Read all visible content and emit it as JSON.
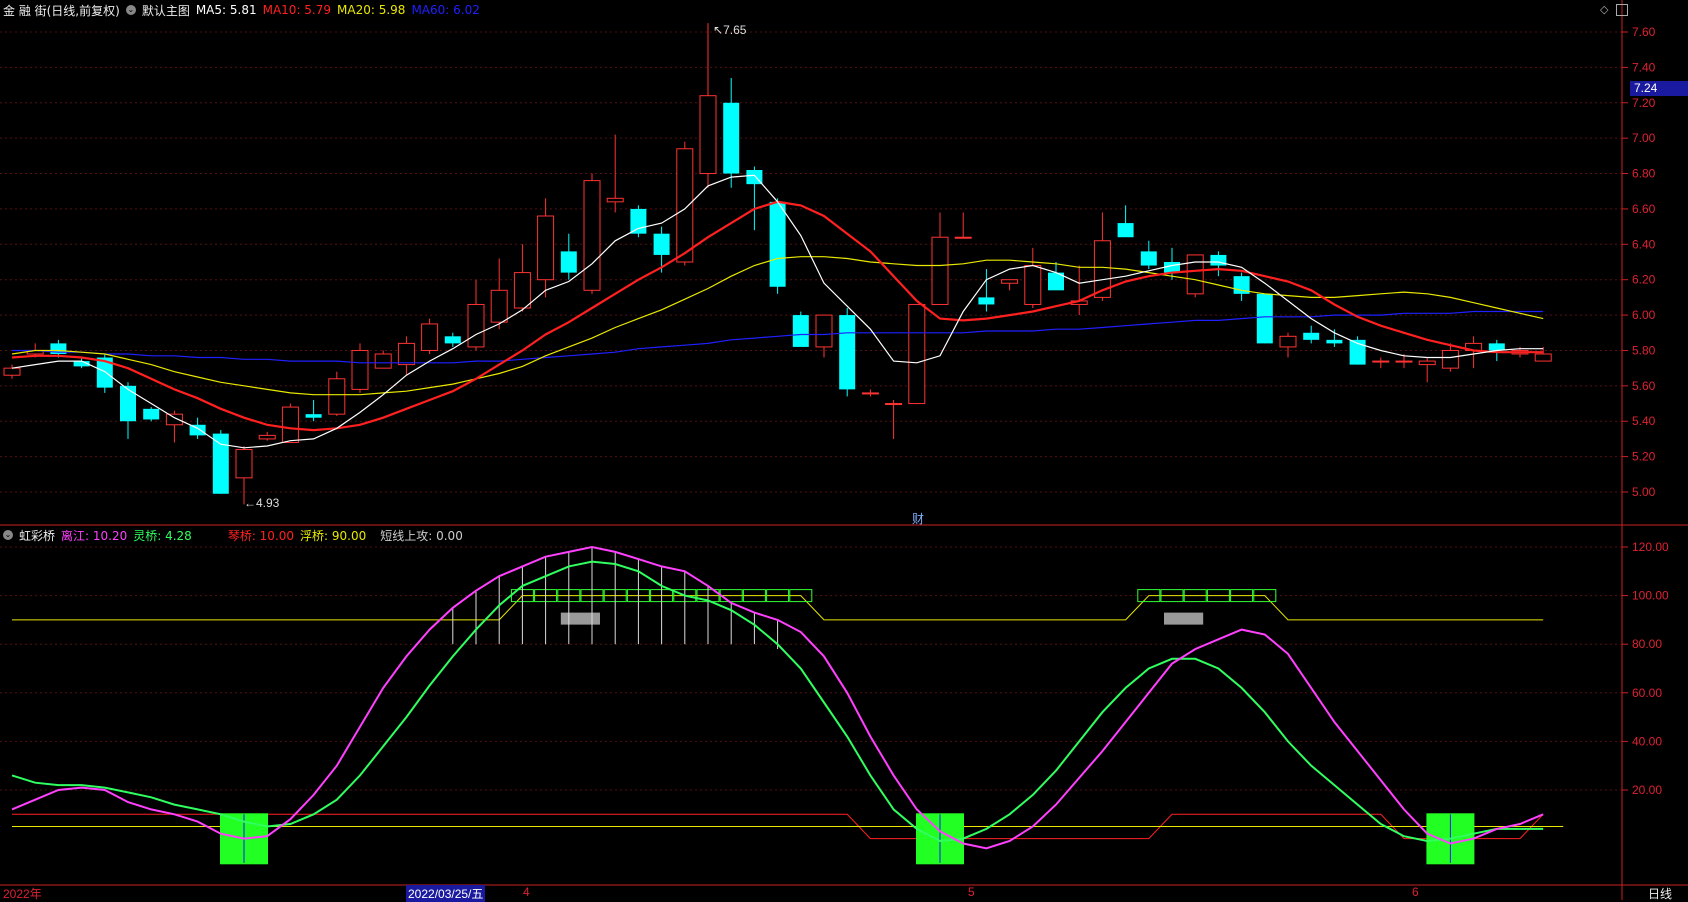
{
  "main_header": {
    "stock": "金 融 街(日线,前复权)",
    "indicator_icon": "circle-chevron-icon",
    "indicator_name": "默认主图",
    "ma5": "MA5: 5.81",
    "ma10": "MA10: 5.79",
    "ma20": "MA20: 5.98",
    "ma60": "MA60: 6.02"
  },
  "sub_header": {
    "indicator_icon": "circle-chevron-icon",
    "name": "虹彩桥",
    "v1": "离江: 10.20",
    "v2": "灵桥: 4.28",
    "v3": "琴桥: 10.00",
    "v4": "浮桥: 90.00",
    "v5": "短线上攻: 0.00"
  },
  "colors": {
    "bg": "#000000",
    "up": "#ff3333",
    "down": "#00ffff",
    "ma5": "#ffffff",
    "ma10": "#ff2020",
    "ma20": "#e8e800",
    "ma60": "#2020ff",
    "axis": "#cc2222"
  },
  "main_axis": {
    "min": 4.8,
    "max": 7.7,
    "ticks": [
      "7.60",
      "7.40",
      "7.20",
      "7.00",
      "6.80",
      "6.60",
      "6.40",
      "6.20",
      "6.00",
      "5.80",
      "5.60",
      "5.40",
      "5.20",
      "5.00"
    ],
    "current_price": "7.24",
    "high_label": "7.65",
    "low_label": "4.93",
    "fin_marker": "财"
  },
  "sub_axis": {
    "min": -10,
    "max": 130,
    "ticks": [
      "120.00",
      "100.00",
      "80.00",
      "60.00",
      "40.00",
      "20.00"
    ]
  },
  "date_axis": {
    "labels": [
      "2022年",
      "2022/03/25/五",
      "4",
      "5",
      "6"
    ],
    "period": "日线"
  },
  "chart_data": {
    "type": "candlestick",
    "candles": [
      [
        5.66,
        5.72,
        5.64,
        5.7
      ],
      [
        5.78,
        5.84,
        5.76,
        5.8
      ],
      [
        5.84,
        5.86,
        5.76,
        5.78
      ],
      [
        5.74,
        5.76,
        5.7,
        5.71
      ],
      [
        5.76,
        5.78,
        5.56,
        5.59
      ],
      [
        5.6,
        5.62,
        5.3,
        5.4
      ],
      [
        5.47,
        5.48,
        5.4,
        5.41
      ],
      [
        5.38,
        5.46,
        5.28,
        5.44
      ],
      [
        5.38,
        5.42,
        5.3,
        5.32
      ],
      [
        5.33,
        5.35,
        4.99,
        4.99
      ],
      [
        5.08,
        5.26,
        4.93,
        5.24
      ],
      [
        5.3,
        5.34,
        5.29,
        5.32
      ],
      [
        5.28,
        5.5,
        5.28,
        5.48
      ],
      [
        5.44,
        5.52,
        5.4,
        5.42
      ],
      [
        5.44,
        5.68,
        5.43,
        5.64
      ],
      [
        5.58,
        5.84,
        5.56,
        5.8
      ],
      [
        5.7,
        5.8,
        5.7,
        5.78
      ],
      [
        5.72,
        5.88,
        5.66,
        5.84
      ],
      [
        5.8,
        5.98,
        5.78,
        5.95
      ],
      [
        5.88,
        5.9,
        5.82,
        5.84
      ],
      [
        5.82,
        6.2,
        5.8,
        6.06
      ],
      [
        5.96,
        6.32,
        5.92,
        6.14
      ],
      [
        6.04,
        6.4,
        6.02,
        6.24
      ],
      [
        6.2,
        6.66,
        6.1,
        6.56
      ],
      [
        6.36,
        6.46,
        6.2,
        6.24
      ],
      [
        6.14,
        6.8,
        6.12,
        6.76
      ],
      [
        6.64,
        7.02,
        6.58,
        6.66
      ],
      [
        6.6,
        6.62,
        6.44,
        6.46
      ],
      [
        6.46,
        6.5,
        6.24,
        6.34
      ],
      [
        6.3,
        6.98,
        6.28,
        6.94
      ],
      [
        6.8,
        7.65,
        6.72,
        7.24
      ],
      [
        7.2,
        7.34,
        6.72,
        6.8
      ],
      [
        6.82,
        6.84,
        6.48,
        6.74
      ],
      [
        6.64,
        6.66,
        6.12,
        6.16
      ],
      [
        6.0,
        6.02,
        5.88,
        5.82
      ],
      [
        5.82,
        6.0,
        5.76,
        6.0
      ],
      [
        6.0,
        6.04,
        5.54,
        5.58
      ],
      [
        5.56,
        5.58,
        5.54,
        5.56
      ],
      [
        5.5,
        5.52,
        5.3,
        5.5
      ],
      [
        5.5,
        6.06,
        5.5,
        6.06
      ],
      [
        6.06,
        6.58,
        6.06,
        6.44
      ],
      [
        6.44,
        6.58,
        6.44,
        6.44
      ],
      [
        6.1,
        6.26,
        6.02,
        6.06
      ],
      [
        6.18,
        6.2,
        6.14,
        6.2
      ],
      [
        6.06,
        6.38,
        6.04,
        6.28
      ],
      [
        6.24,
        6.3,
        6.14,
        6.14
      ],
      [
        6.06,
        6.28,
        6.0,
        6.08
      ],
      [
        6.1,
        6.58,
        6.08,
        6.42
      ],
      [
        6.52,
        6.62,
        6.46,
        6.44
      ],
      [
        6.36,
        6.42,
        6.26,
        6.28
      ],
      [
        6.3,
        6.38,
        6.2,
        6.24
      ],
      [
        6.12,
        6.34,
        6.1,
        6.34
      ],
      [
        6.34,
        6.36,
        6.22,
        6.28
      ],
      [
        6.22,
        6.24,
        6.08,
        6.12
      ],
      [
        6.12,
        6.12,
        5.84,
        5.84
      ],
      [
        5.82,
        5.9,
        5.76,
        5.88
      ],
      [
        5.9,
        5.94,
        5.84,
        5.86
      ],
      [
        5.86,
        5.92,
        5.82,
        5.84
      ],
      [
        5.86,
        5.88,
        5.72,
        5.72
      ],
      [
        5.74,
        5.76,
        5.7,
        5.74
      ],
      [
        5.74,
        5.78,
        5.7,
        5.74
      ],
      [
        5.72,
        5.76,
        5.62,
        5.74
      ],
      [
        5.7,
        5.84,
        5.68,
        5.8
      ],
      [
        5.8,
        5.88,
        5.7,
        5.84
      ],
      [
        5.84,
        5.86,
        5.74,
        5.8
      ],
      [
        5.78,
        5.82,
        5.76,
        5.8
      ],
      [
        5.74,
        5.82,
        5.74,
        5.78
      ]
    ],
    "ma5": [
      5.7,
      5.72,
      5.74,
      5.74,
      5.68,
      5.58,
      5.5,
      5.42,
      5.36,
      5.27,
      5.25,
      5.26,
      5.29,
      5.3,
      5.36,
      5.45,
      5.55,
      5.66,
      5.74,
      5.81,
      5.89,
      5.95,
      6.03,
      6.14,
      6.19,
      6.29,
      6.42,
      6.49,
      6.52,
      6.6,
      6.73,
      6.78,
      6.79,
      6.64,
      6.45,
      6.18,
      6.05,
      5.92,
      5.74,
      5.73,
      5.77,
      6.02,
      6.2,
      6.26,
      6.28,
      6.24,
      6.18,
      6.2,
      6.22,
      6.25,
      6.28,
      6.3,
      6.3,
      6.27,
      6.18,
      6.08,
      5.98,
      5.9,
      5.84,
      5.8,
      5.77,
      5.76,
      5.76,
      5.78,
      5.8,
      5.81,
      5.81
    ],
    "ma10": [
      5.76,
      5.77,
      5.77,
      5.76,
      5.74,
      5.7,
      5.64,
      5.58,
      5.53,
      5.47,
      5.42,
      5.38,
      5.36,
      5.35,
      5.36,
      5.38,
      5.42,
      5.47,
      5.52,
      5.57,
      5.64,
      5.72,
      5.8,
      5.89,
      5.96,
      6.04,
      6.12,
      6.2,
      6.27,
      6.35,
      6.44,
      6.52,
      6.6,
      6.64,
      6.62,
      6.56,
      6.46,
      6.36,
      6.22,
      6.08,
      5.98,
      5.97,
      5.98,
      6.0,
      6.02,
      6.05,
      6.08,
      6.14,
      6.19,
      6.22,
      6.24,
      6.25,
      6.26,
      6.25,
      6.22,
      6.19,
      6.14,
      6.06,
      5.99,
      5.94,
      5.9,
      5.86,
      5.83,
      5.8,
      5.79,
      5.79,
      5.79
    ],
    "ma20": [
      5.78,
      5.8,
      5.8,
      5.79,
      5.78,
      5.75,
      5.72,
      5.68,
      5.65,
      5.62,
      5.6,
      5.58,
      5.56,
      5.55,
      5.55,
      5.55,
      5.56,
      5.57,
      5.59,
      5.61,
      5.64,
      5.67,
      5.71,
      5.77,
      5.82,
      5.87,
      5.93,
      5.98,
      6.03,
      6.09,
      6.15,
      6.22,
      6.28,
      6.32,
      6.33,
      6.33,
      6.32,
      6.3,
      6.29,
      6.28,
      6.28,
      6.29,
      6.31,
      6.31,
      6.3,
      6.29,
      6.27,
      6.27,
      6.26,
      6.24,
      6.22,
      6.2,
      6.17,
      6.14,
      6.12,
      6.11,
      6.1,
      6.1,
      6.11,
      6.12,
      6.13,
      6.12,
      6.1,
      6.07,
      6.04,
      6.01,
      5.98
    ],
    "ma60": [
      5.8,
      5.8,
      5.79,
      5.79,
      5.78,
      5.78,
      5.77,
      5.77,
      5.76,
      5.76,
      5.75,
      5.75,
      5.74,
      5.74,
      5.74,
      5.73,
      5.73,
      5.73,
      5.73,
      5.73,
      5.74,
      5.74,
      5.75,
      5.76,
      5.77,
      5.78,
      5.79,
      5.81,
      5.82,
      5.83,
      5.84,
      5.86,
      5.87,
      5.88,
      5.89,
      5.89,
      5.9,
      5.9,
      5.9,
      5.9,
      5.9,
      5.9,
      5.91,
      5.91,
      5.91,
      5.92,
      5.92,
      5.93,
      5.94,
      5.95,
      5.96,
      5.97,
      5.97,
      5.98,
      5.99,
      5.99,
      5.99,
      6.0,
      6.0,
      6.0,
      6.01,
      6.01,
      6.01,
      6.02,
      6.02,
      6.02,
      6.02
    ],
    "lijiang": [
      12,
      16,
      20,
      21,
      20,
      15,
      12,
      10,
      7,
      2,
      0,
      1,
      8,
      18,
      30,
      46,
      62,
      75,
      86,
      95,
      102,
      108,
      112,
      116,
      118,
      120,
      118,
      115,
      112,
      110,
      104,
      97,
      93,
      90,
      85,
      75,
      60,
      42,
      26,
      12,
      3,
      -2,
      -4,
      -1,
      5,
      14,
      25,
      36,
      48,
      60,
      72,
      78,
      82,
      86,
      84,
      76,
      62,
      48,
      36,
      24,
      12,
      2,
      -2,
      0,
      4,
      6,
      10
    ],
    "lingqiao": [
      26,
      23,
      22,
      22,
      21,
      19,
      17,
      14,
      12,
      10,
      7,
      5,
      6,
      10,
      16,
      26,
      38,
      50,
      63,
      75,
      86,
      96,
      104,
      108,
      112,
      114,
      113,
      110,
      104,
      100,
      98,
      94,
      88,
      80,
      70,
      56,
      42,
      26,
      12,
      4,
      -1,
      0,
      4,
      10,
      18,
      28,
      40,
      52,
      62,
      70,
      74,
      74,
      70,
      62,
      52,
      40,
      30,
      22,
      14,
      6,
      1,
      -1,
      0,
      2,
      4,
      4,
      4
    ],
    "qinqiao": [
      10,
      10,
      10,
      10,
      10,
      10,
      10,
      10,
      10,
      10,
      10,
      10,
      10,
      10,
      10,
      10,
      10,
      10,
      10,
      10,
      10,
      10,
      10,
      10,
      10,
      10,
      10,
      10,
      10,
      10,
      10,
      10,
      10,
      10,
      10,
      10,
      10,
      0,
      0,
      0,
      0,
      0,
      0,
      0,
      0,
      0,
      0,
      0,
      0,
      0,
      10,
      10,
      10,
      10,
      10,
      10,
      10,
      10,
      10,
      10,
      0,
      0,
      0,
      0,
      0,
      0,
      10
    ],
    "fuqiao": [
      90,
      90,
      90,
      90,
      90,
      90,
      90,
      90,
      90,
      90,
      90,
      90,
      90,
      90,
      90,
      90,
      90,
      90,
      90,
      90,
      90,
      90,
      100,
      100,
      100,
      100,
      100,
      100,
      100,
      100,
      100,
      100,
      100,
      100,
      100,
      90,
      90,
      90,
      90,
      90,
      90,
      90,
      90,
      90,
      90,
      90,
      90,
      90,
      90,
      100,
      100,
      100,
      100,
      100,
      100,
      90,
      90,
      90,
      90,
      90,
      90,
      90,
      90,
      90,
      90,
      90,
      90
    ]
  }
}
